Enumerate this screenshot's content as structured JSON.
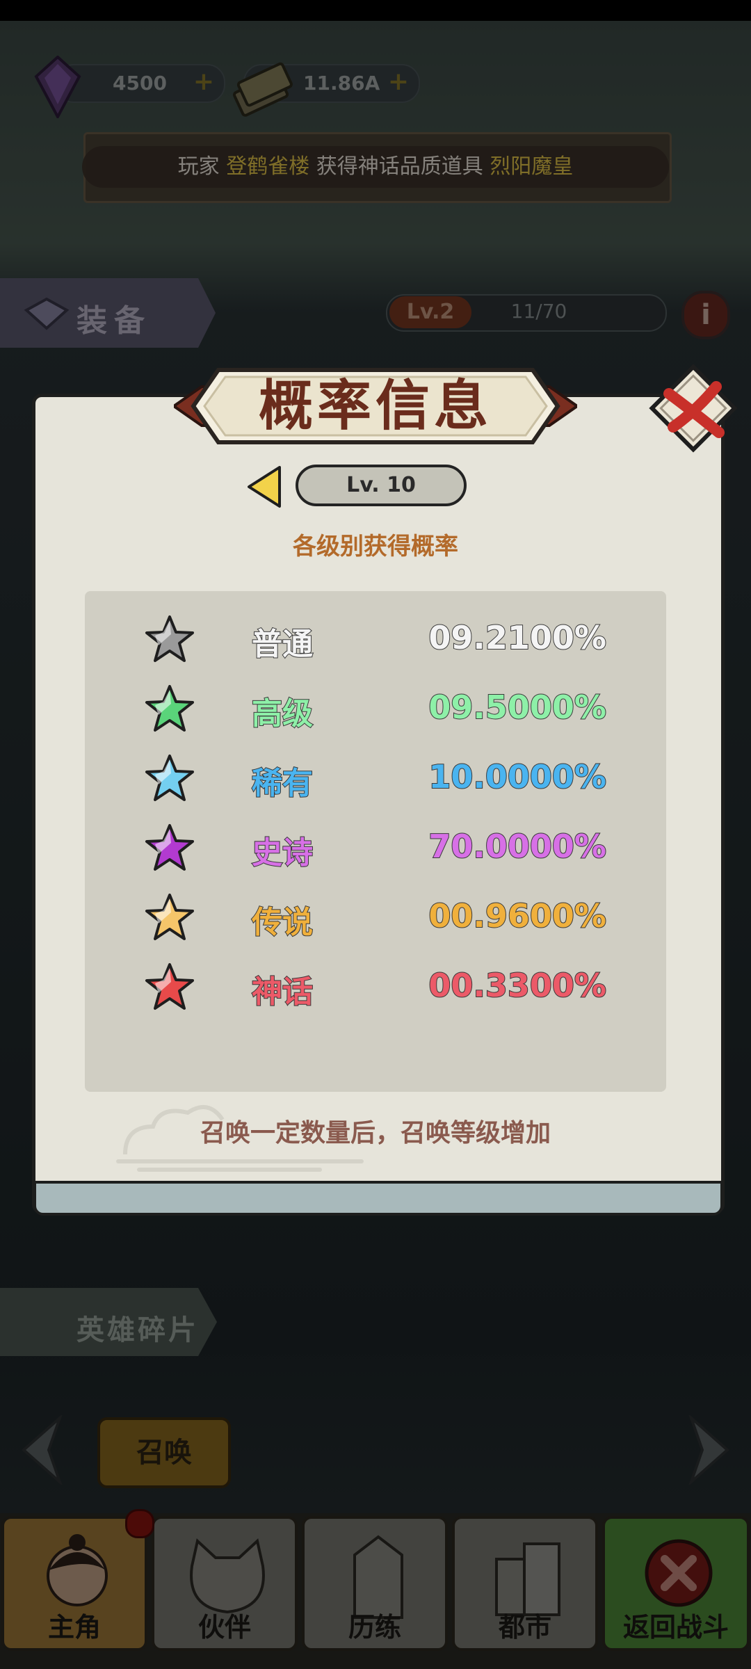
{
  "top_bar": {
    "gems": "4500",
    "cash": "11.86A",
    "plus": "+"
  },
  "broadcast": {
    "prefix": "玩家",
    "player": "登鹤雀楼",
    "middle": "获得神话品质道具",
    "item": "烈阳魔皇"
  },
  "equipment": {
    "tab_label": "装备",
    "level": "Lv.2",
    "progress": "11/70",
    "info": "i"
  },
  "modal": {
    "title": "概率信息",
    "level": "Lv. 10",
    "subtitle": "各级别获得概率",
    "rates": [
      {
        "name": "普通",
        "value": "09.2100%",
        "color": "#f4f4f4",
        "star": "#9a9a9a"
      },
      {
        "name": "高级",
        "value": "09.5000%",
        "color": "#8ef0a8",
        "star": "#5ad47a"
      },
      {
        "name": "稀有",
        "value": "10.0000%",
        "color": "#4ab4f0",
        "star": "#74cff0"
      },
      {
        "name": "史诗",
        "value": "70.0000%",
        "color": "#d770e6",
        "star": "#b23ad0"
      },
      {
        "name": "传说",
        "value": "00.9600%",
        "color": "#f0b03c",
        "star": "#f5c56a"
      },
      {
        "name": "神话",
        "value": "00.3300%",
        "color": "#ec5a68",
        "star": "#e84a4a"
      }
    ],
    "footnote": "召唤一定数量后，召唤等级增加"
  },
  "hero_shards": {
    "label": "英雄碎片"
  },
  "summon_button": "召唤",
  "bottom_nav": [
    {
      "label": "主角",
      "bg": "#a07a3a"
    },
    {
      "label": "伙伴",
      "bg": "#7b7b74"
    },
    {
      "label": "历练",
      "bg": "#7b7b74"
    },
    {
      "label": "都市",
      "bg": "#7b7b74"
    },
    {
      "label": "返回战斗",
      "bg": "#4f8a3a"
    }
  ]
}
